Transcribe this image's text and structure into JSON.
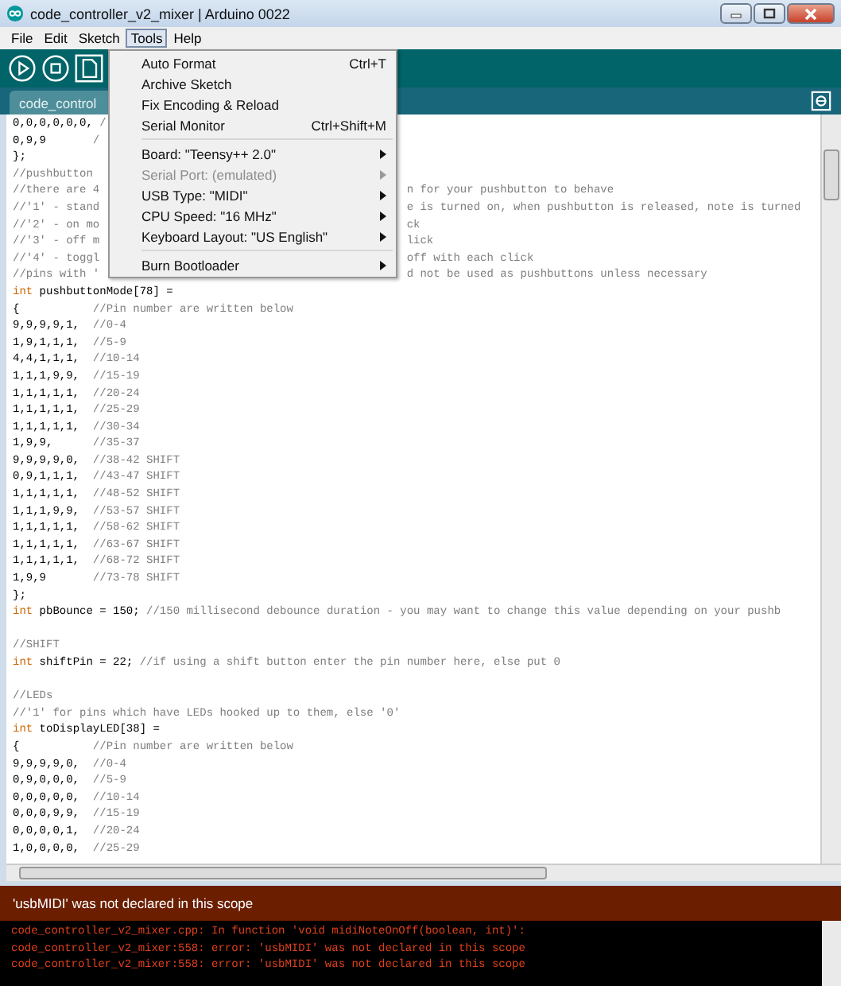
{
  "window": {
    "title": "code_controller_v2_mixer | Arduino 0022"
  },
  "menubar": [
    {
      "label": "File",
      "selected": false
    },
    {
      "label": "Edit",
      "selected": false
    },
    {
      "label": "Sketch",
      "selected": false
    },
    {
      "label": "Tools",
      "selected": true
    },
    {
      "label": "Help",
      "selected": false
    }
  ],
  "tabs": [
    {
      "label": "code_control"
    }
  ],
  "editor": {
    "lines": [
      {
        "left": [
          {
            "kind": "code",
            "text": "0,0,0,0,0,0, "
          },
          {
            "kind": "comment",
            "text": "/"
          }
        ]
      },
      {
        "left": [
          {
            "kind": "code",
            "text": "0,9,9       "
          },
          {
            "kind": "comment",
            "text": "/"
          }
        ]
      },
      {
        "left": [
          {
            "kind": "code",
            "text": "};"
          }
        ]
      },
      {
        "left": [
          {
            "kind": "comment",
            "text": "//pushbutton"
          }
        ]
      },
      {
        "left": [
          {
            "kind": "comment",
            "text": "//there are 4"
          }
        ],
        "right": [
          {
            "kind": "comment",
            "text": "n for your pushbutton to behave"
          }
        ]
      },
      {
        "left": [
          {
            "kind": "comment",
            "text": "//'1' - stand"
          }
        ],
        "right": [
          {
            "kind": "comment",
            "text": "e is turned on, when pushbutton is released, note is turned"
          }
        ]
      },
      {
        "left": [
          {
            "kind": "comment",
            "text": "//'2' - on mo"
          }
        ],
        "right": [
          {
            "kind": "comment",
            "text": "ck"
          }
        ]
      },
      {
        "left": [
          {
            "kind": "comment",
            "text": "//'3' - off m"
          }
        ],
        "right": [
          {
            "kind": "comment",
            "text": "lick"
          }
        ]
      },
      {
        "left": [
          {
            "kind": "comment",
            "text": "//'4' - toggl"
          }
        ],
        "right": [
          {
            "kind": "comment",
            "text": "off with each click"
          }
        ]
      },
      {
        "left": [
          {
            "kind": "comment",
            "text": "//pins with '"
          }
        ],
        "right": [
          {
            "kind": "comment",
            "text": "d not be used as pushbuttons unless necessary"
          }
        ]
      },
      {
        "left": [
          {
            "kind": "keyword",
            "text": "int"
          },
          {
            "kind": "code",
            "text": " pushbuttonMode[78] ="
          }
        ]
      },
      {
        "left": [
          {
            "kind": "code",
            "text": "{           "
          },
          {
            "kind": "comment",
            "text": "//Pin number are written below"
          }
        ]
      },
      {
        "left": [
          {
            "kind": "code",
            "text": "9,9,9,9,1,  "
          },
          {
            "kind": "comment",
            "text": "//0-4"
          }
        ]
      },
      {
        "left": [
          {
            "kind": "code",
            "text": "1,9,1,1,1,  "
          },
          {
            "kind": "comment",
            "text": "//5-9"
          }
        ]
      },
      {
        "left": [
          {
            "kind": "code",
            "text": "4,4,1,1,1,  "
          },
          {
            "kind": "comment",
            "text": "//10-14"
          }
        ]
      },
      {
        "left": [
          {
            "kind": "code",
            "text": "1,1,1,9,9,  "
          },
          {
            "kind": "comment",
            "text": "//15-19"
          }
        ]
      },
      {
        "left": [
          {
            "kind": "code",
            "text": "1,1,1,1,1,  "
          },
          {
            "kind": "comment",
            "text": "//20-24"
          }
        ]
      },
      {
        "left": [
          {
            "kind": "code",
            "text": "1,1,1,1,1,  "
          },
          {
            "kind": "comment",
            "text": "//25-29"
          }
        ]
      },
      {
        "left": [
          {
            "kind": "code",
            "text": "1,1,1,1,1,  "
          },
          {
            "kind": "comment",
            "text": "//30-34"
          }
        ]
      },
      {
        "left": [
          {
            "kind": "code",
            "text": "1,9,9,      "
          },
          {
            "kind": "comment",
            "text": "//35-37"
          }
        ]
      },
      {
        "left": [
          {
            "kind": "code",
            "text": "9,9,9,9,0,  "
          },
          {
            "kind": "comment",
            "text": "//38-42 SHIFT"
          }
        ]
      },
      {
        "left": [
          {
            "kind": "code",
            "text": "0,9,1,1,1,  "
          },
          {
            "kind": "comment",
            "text": "//43-47 SHIFT"
          }
        ]
      },
      {
        "left": [
          {
            "kind": "code",
            "text": "1,1,1,1,1,  "
          },
          {
            "kind": "comment",
            "text": "//48-52 SHIFT"
          }
        ]
      },
      {
        "left": [
          {
            "kind": "code",
            "text": "1,1,1,9,9,  "
          },
          {
            "kind": "comment",
            "text": "//53-57 SHIFT"
          }
        ]
      },
      {
        "left": [
          {
            "kind": "code",
            "text": "1,1,1,1,1,  "
          },
          {
            "kind": "comment",
            "text": "//58-62 SHIFT"
          }
        ]
      },
      {
        "left": [
          {
            "kind": "code",
            "text": "1,1,1,1,1,  "
          },
          {
            "kind": "comment",
            "text": "//63-67 SHIFT"
          }
        ]
      },
      {
        "left": [
          {
            "kind": "code",
            "text": "1,1,1,1,1,  "
          },
          {
            "kind": "comment",
            "text": "//68-72 SHIFT"
          }
        ]
      },
      {
        "left": [
          {
            "kind": "code",
            "text": "1,9,9       "
          },
          {
            "kind": "comment",
            "text": "//73-78 SHIFT"
          }
        ]
      },
      {
        "left": [
          {
            "kind": "code",
            "text": "};"
          }
        ]
      },
      {
        "left": [
          {
            "kind": "keyword",
            "text": "int"
          },
          {
            "kind": "code",
            "text": " pbBounce = 150; "
          },
          {
            "kind": "comment",
            "text": "//150 millisecond debounce duration - you may want to change this value depending on your pushb"
          }
        ]
      },
      {
        "kind": "blank"
      },
      {
        "left": [
          {
            "kind": "comment",
            "text": "//SHIFT"
          }
        ]
      },
      {
        "left": [
          {
            "kind": "keyword",
            "text": "int"
          },
          {
            "kind": "code",
            "text": " shiftPin = 22; "
          },
          {
            "kind": "comment",
            "text": "//if using a shift button enter the pin number here, else put 0"
          }
        ]
      },
      {
        "kind": "blank"
      },
      {
        "left": [
          {
            "kind": "comment",
            "text": "//LEDs"
          }
        ]
      },
      {
        "left": [
          {
            "kind": "comment",
            "text": "//'1' for pins which have LEDs hooked up to them, else '0'"
          }
        ]
      },
      {
        "left": [
          {
            "kind": "keyword",
            "text": "int"
          },
          {
            "kind": "code",
            "text": " toDisplayLED[38] ="
          }
        ]
      },
      {
        "left": [
          {
            "kind": "code",
            "text": "{           "
          },
          {
            "kind": "comment",
            "text": "//Pin number are written below"
          }
        ]
      },
      {
        "left": [
          {
            "kind": "code",
            "text": "9,9,9,9,0,  "
          },
          {
            "kind": "comment",
            "text": "//0-4"
          }
        ]
      },
      {
        "left": [
          {
            "kind": "code",
            "text": "0,9,0,0,0,  "
          },
          {
            "kind": "comment",
            "text": "//5-9"
          }
        ]
      },
      {
        "left": [
          {
            "kind": "code",
            "text": "0,0,0,0,0,  "
          },
          {
            "kind": "comment",
            "text": "//10-14"
          }
        ]
      },
      {
        "left": [
          {
            "kind": "code",
            "text": "0,0,0,9,9,  "
          },
          {
            "kind": "comment",
            "text": "//15-19"
          }
        ]
      },
      {
        "left": [
          {
            "kind": "code",
            "text": "0,0,0,0,1,  "
          },
          {
            "kind": "comment",
            "text": "//20-24"
          }
        ]
      },
      {
        "left": [
          {
            "kind": "code",
            "text": "1,0,0,0,0,  "
          },
          {
            "kind": "comment",
            "text": "//25-29"
          }
        ]
      }
    ]
  },
  "tools_menu": [
    {
      "kind": "item",
      "label": "Auto Format",
      "shortcut": "Ctrl+T"
    },
    {
      "kind": "item",
      "label": "Archive Sketch"
    },
    {
      "kind": "item",
      "label": "Fix Encoding & Reload"
    },
    {
      "kind": "item",
      "label": "Serial Monitor",
      "shortcut": "Ctrl+Shift+M"
    },
    {
      "kind": "separator"
    },
    {
      "kind": "submenu",
      "label": "Board: \"Teensy++ 2.0\"",
      "disabled": false
    },
    {
      "kind": "submenu",
      "label": "Serial Port: (emulated)",
      "disabled": true
    },
    {
      "kind": "submenu",
      "label": "USB Type: \"MIDI\"",
      "disabled": false
    },
    {
      "kind": "submenu",
      "label": "CPU Speed: \"16 MHz\"",
      "disabled": false
    },
    {
      "kind": "submenu",
      "label": "Keyboard Layout: \"US English\"",
      "disabled": false
    },
    {
      "kind": "separator"
    },
    {
      "kind": "submenu",
      "label": "Burn Bootloader",
      "disabled": false
    }
  ],
  "status": {
    "message": "'usbMIDI' was not declared in this scope"
  },
  "console": {
    "lines": [
      "code_controller_v2_mixer.cpp: In function 'void midiNoteOnOff(boolean, int)':",
      "code_controller_v2_mixer:558: error: 'usbMIDI' was not declared in this scope",
      "code_controller_v2_mixer:558: error: 'usbMIDI' was not declared in this scope"
    ]
  }
}
